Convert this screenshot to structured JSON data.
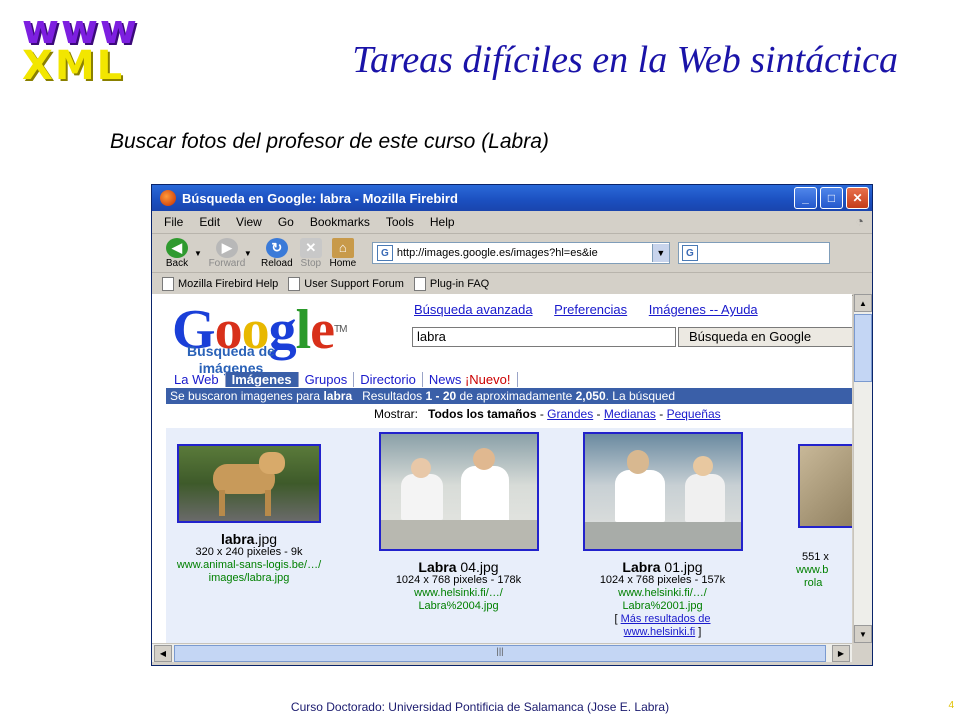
{
  "slide": {
    "logo_line1": "www",
    "logo_line2": "XML",
    "title": "Tareas difíciles en la Web sintáctica",
    "subtitle": "Buscar fotos del profesor de este curso (Labra)",
    "footer": "Curso Doctorado: Universidad Pontificia de Salamanca (Jose E. Labra)",
    "page_number": "4"
  },
  "window": {
    "title": "Búsqueda en Google: labra - Mozilla Firebird"
  },
  "menu": [
    "File",
    "Edit",
    "View",
    "Go",
    "Bookmarks",
    "Tools",
    "Help"
  ],
  "nav": {
    "back": "Back",
    "forward": "Forward",
    "reload": "Reload",
    "stop": "Stop",
    "home": "Home",
    "url": "http://images.google.es/images?hl=es&ie"
  },
  "bookmarks": [
    "Mozilla Firebird Help",
    "User Support Forum",
    "Plug-in FAQ"
  ],
  "google": {
    "logo": "Google",
    "tm": "TM",
    "sub1": "Búsqueda de",
    "sub2": "imágenes",
    "links": [
      "Búsqueda avanzada",
      "Preferencias",
      "Imágenes -- Ayuda"
    ],
    "query": "labra",
    "search_button": "Búsqueda en Google",
    "tabs": [
      "La Web",
      "Imágenes",
      "Grupos",
      "Directorio",
      "News"
    ],
    "nuevo": "¡Nuevo!",
    "results_pre": "Se buscaron imagenes para ",
    "results_query": "labra",
    "results_mid1": "   Resultados ",
    "results_range": "1 - 20",
    "results_mid2": " de aproximadamente ",
    "results_count": "2,050",
    "results_post": ". La búsqued",
    "show_label": "Mostrar:",
    "show_all": "Todos los tamaños",
    "sep": " - ",
    "show_sizes": [
      "Grandes",
      "Medianas",
      "Pequeñas"
    ]
  },
  "results": [
    {
      "name_bold": "labra",
      "name_rest": ".jpg",
      "size": "320 x 240 pixeles - 9k",
      "url1": "www.animal-sans-logis.be/…/",
      "url2": "images/labra.jpg"
    },
    {
      "name_bold": "Labra",
      "name_rest": " 04.jpg",
      "size": "1024 x 768 pixeles - 178k",
      "url1": "www.helsinki.fi/…/",
      "url2": "Labra%2004.jpg"
    },
    {
      "name_bold": "Labra",
      "name_rest": " 01.jpg",
      "size": "1024 x 768 pixeles - 157k",
      "url1": "www.helsinki.fi/…/",
      "url2": "Labra%2001.jpg",
      "more_open": "[ ",
      "more_link1": "Más resultados de",
      "more_link2": "www.helsinki.fi",
      "more_close": " ]"
    },
    {
      "name_bold": "",
      "name_rest": "",
      "size": "551 x",
      "url1": "www.b",
      "url2": "rola"
    }
  ],
  "colors": {
    "title": "#1a13a8",
    "logo_purple": "#7d1fe0",
    "logo_yellow": "#f2e600",
    "titlebar": "#2a69d8",
    "google_bar": "#3a5fa8",
    "link": "#1a1acc",
    "url_green": "#008000"
  }
}
